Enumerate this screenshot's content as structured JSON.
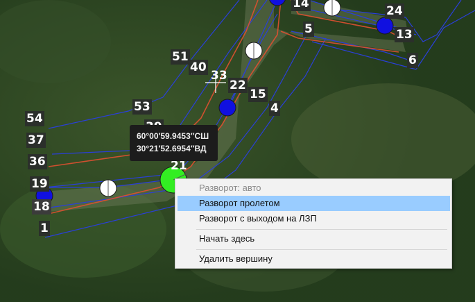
{
  "map": {
    "point_labels": [
      "14",
      "24",
      "5",
      "13",
      "6",
      "51",
      "40",
      "33",
      "22",
      "15",
      "4",
      "53",
      "54",
      "39",
      "37",
      "36",
      "21",
      "19",
      "18",
      "1"
    ]
  },
  "coordinates": {
    "lat": "60°00′59.9453″СШ",
    "lon": "30°21′52.6954″ВД"
  },
  "context_menu": {
    "items": [
      {
        "label": "Разворот: авто",
        "state": "disabled"
      },
      {
        "label": "Разворот пролетом",
        "state": "highlighted"
      },
      {
        "label": "Разворот с выходом на ЛЗП",
        "state": "normal"
      },
      {
        "label": "Начать здесь",
        "state": "normal"
      },
      {
        "label": "Удалить вершину",
        "state": "normal"
      }
    ]
  },
  "colors": {
    "route_line": "#2a3fd8",
    "border_line": "#e05030",
    "vertex_blue": "#1010e0",
    "vertex_selected": "#33ee22",
    "menu_highlight": "#99ccff"
  }
}
